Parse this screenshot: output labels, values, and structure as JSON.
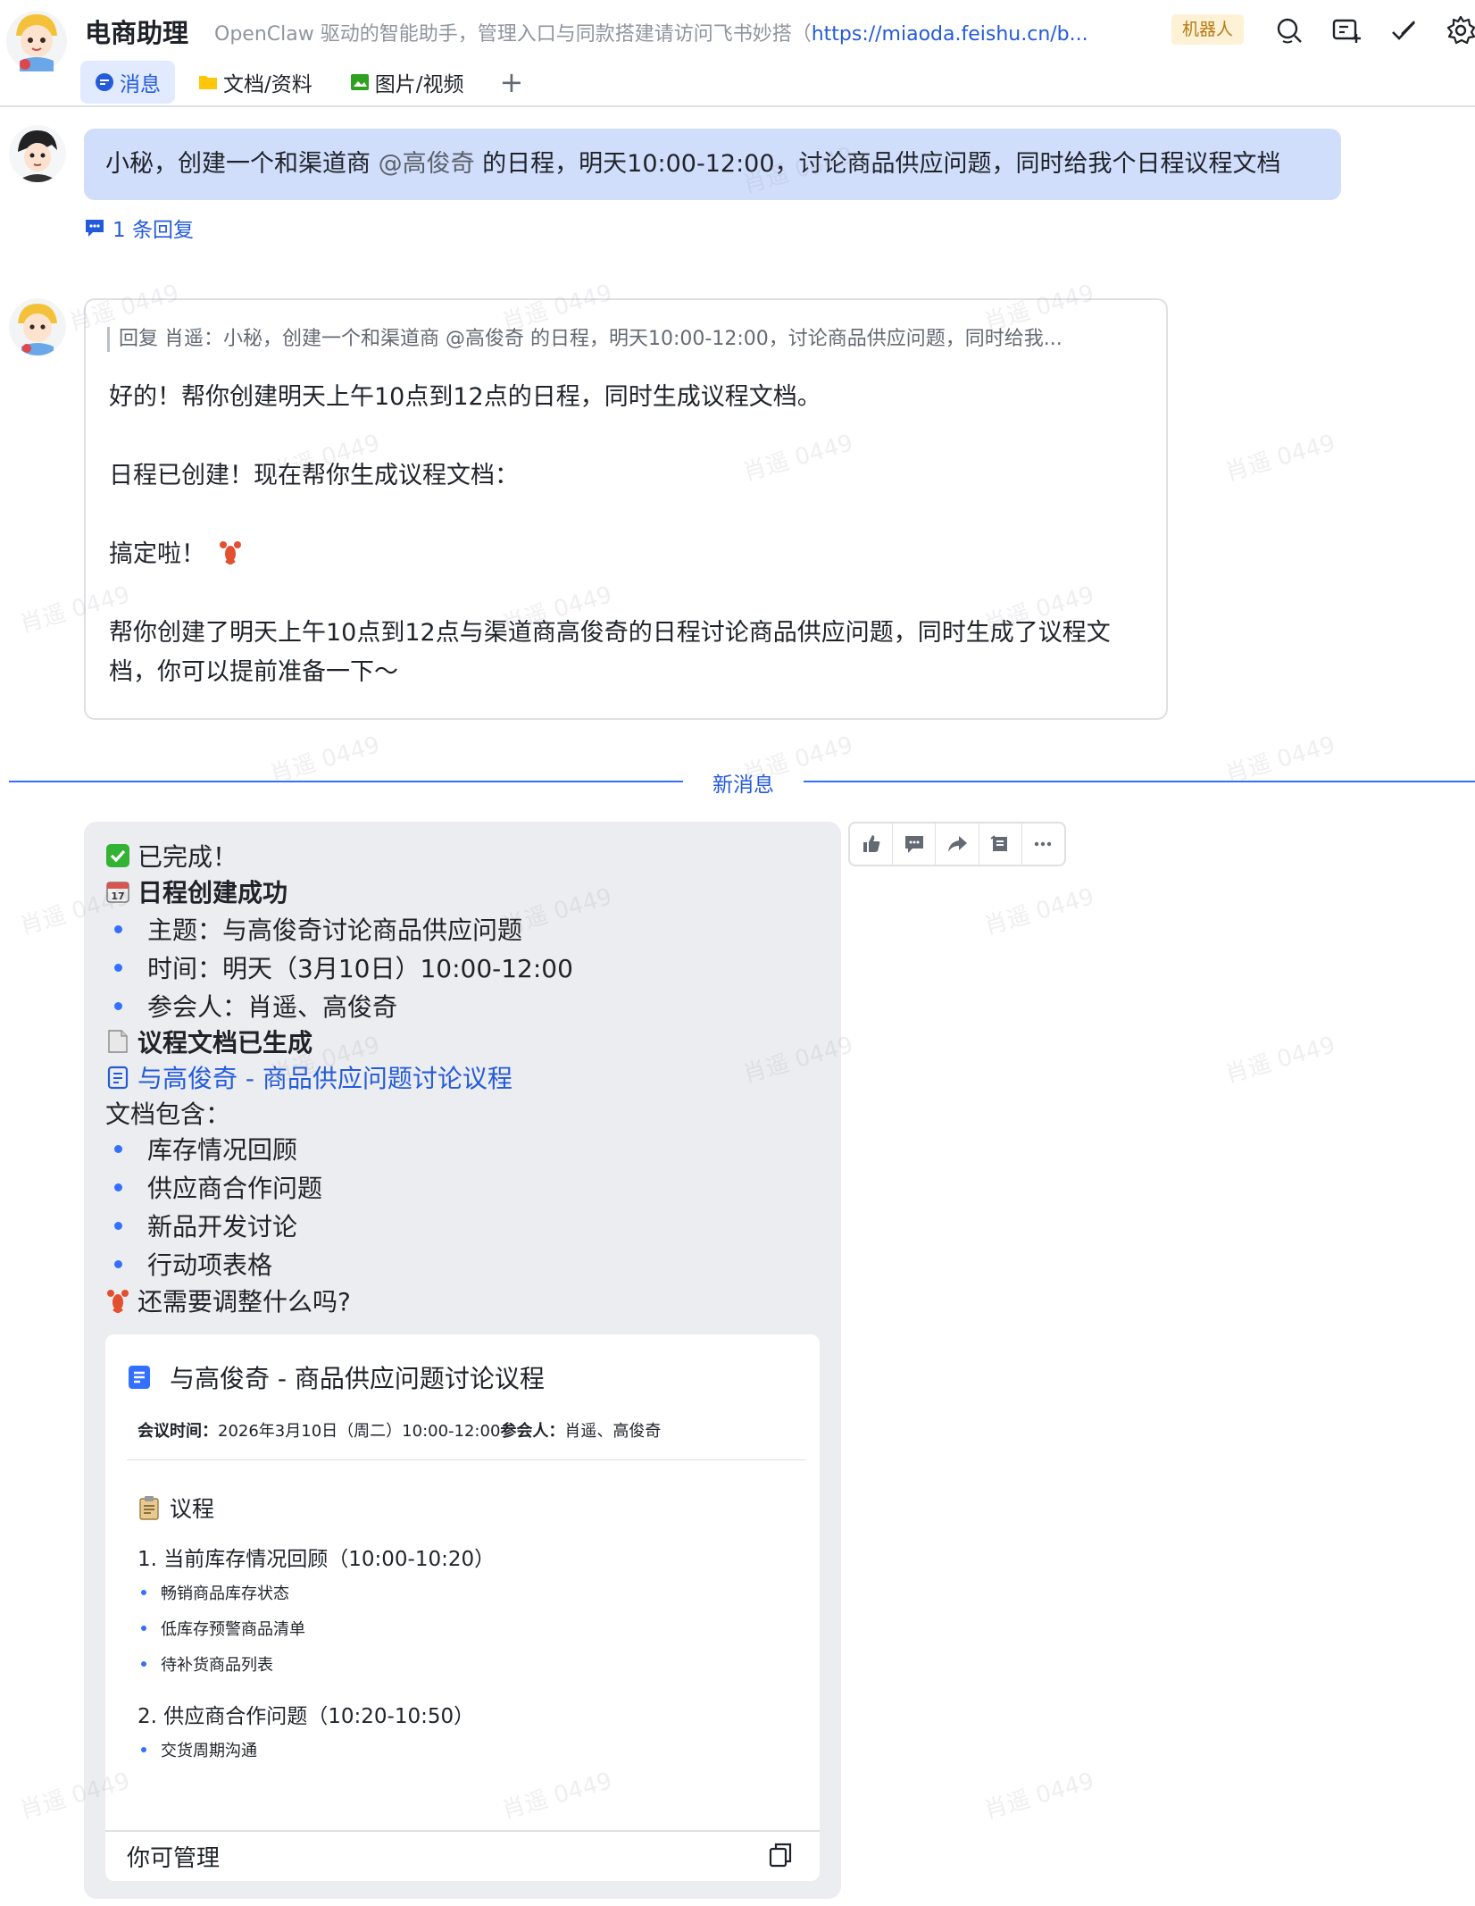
{
  "header": {
    "title": "电商助理",
    "description_prefix": "OpenClaw 驱动的智能助手，管理入口与同款搭建请访问飞书妙搭（",
    "description_link": "https://miaoda.feishu.cn/b...",
    "bot_badge": "机器人",
    "tabs": [
      {
        "label": "消息",
        "icon": "chat-icon",
        "active": true
      },
      {
        "label": "文档/资料",
        "icon": "folder-icon",
        "active": false
      },
      {
        "label": "图片/视频",
        "icon": "image-icon",
        "active": false
      }
    ],
    "add_tab": "+"
  },
  "user_message": {
    "text_before": "小秘，创建一个和渠道商 ",
    "mention": "@高俊奇",
    "text_after": " 的日程，明天10:00-12:00，讨论商品供应问题，同时给我个日程议程文档",
    "reply_count": "1 条回复"
  },
  "bot_reply": {
    "quote": "回复 肖遥：小秘，创建一个和渠道商 @高俊奇 的日程，明天10:00-12:00，讨论商品供应问题，同时给我...",
    "lines": [
      "好的！帮你创建明天上午10点到12点的日程，同时生成议程文档。",
      "日程已创建！现在帮你生成议程文档：",
      "搞定啦！",
      "帮你创建了明天上午10点到12点与渠道商高俊奇的日程讨论商品供应问题，同时生成了议程文",
      "档，你可以提前准备一下～"
    ]
  },
  "divider": {
    "label": "新消息"
  },
  "bot_final": {
    "done": "已完成！",
    "schedule_title": "日程创建成功",
    "schedule_items": [
      "主题：与高俊奇讨论商品供应问题",
      "时间：明天（3月10日）10:00-12:00",
      "参会人：肖遥、高俊奇"
    ],
    "doc_generated": "议程文档已生成",
    "doc_link": "与高俊奇 - 商品供应问题讨论议程",
    "doc_includes": "文档包含：",
    "doc_items": [
      "库存情况回顾",
      "供应商合作问题",
      "新品开发讨论",
      "行动项表格"
    ],
    "followup": "还需要调整什么吗?"
  },
  "doc_card": {
    "title": "与高俊奇 - 商品供应问题讨论议程",
    "meta_time_label": "会议时间：",
    "meta_time": "2026年3月10日（周二）10:00-12:00",
    "meta_people_label": "参会人：",
    "meta_people": "肖遥、高俊奇",
    "agenda_heading": "议程",
    "section1": "1. 当前库存情况回顾（10:00-10:20）",
    "section1_items": [
      "畅销商品库存状态",
      "低库存预警商品清单",
      "待补货商品列表"
    ],
    "section2": "2. 供应商合作问题（10:20-10:50）",
    "section2_items": [
      "交货周期沟通"
    ],
    "footer": "你可管理"
  },
  "watermark": "肖遥 0449",
  "colors": {
    "accent": "#245bdb",
    "bubble": "#d1defb",
    "bot_bg": "#ecedf0",
    "divider": "#3370ff",
    "badge_bg": "#fdf1d6"
  }
}
